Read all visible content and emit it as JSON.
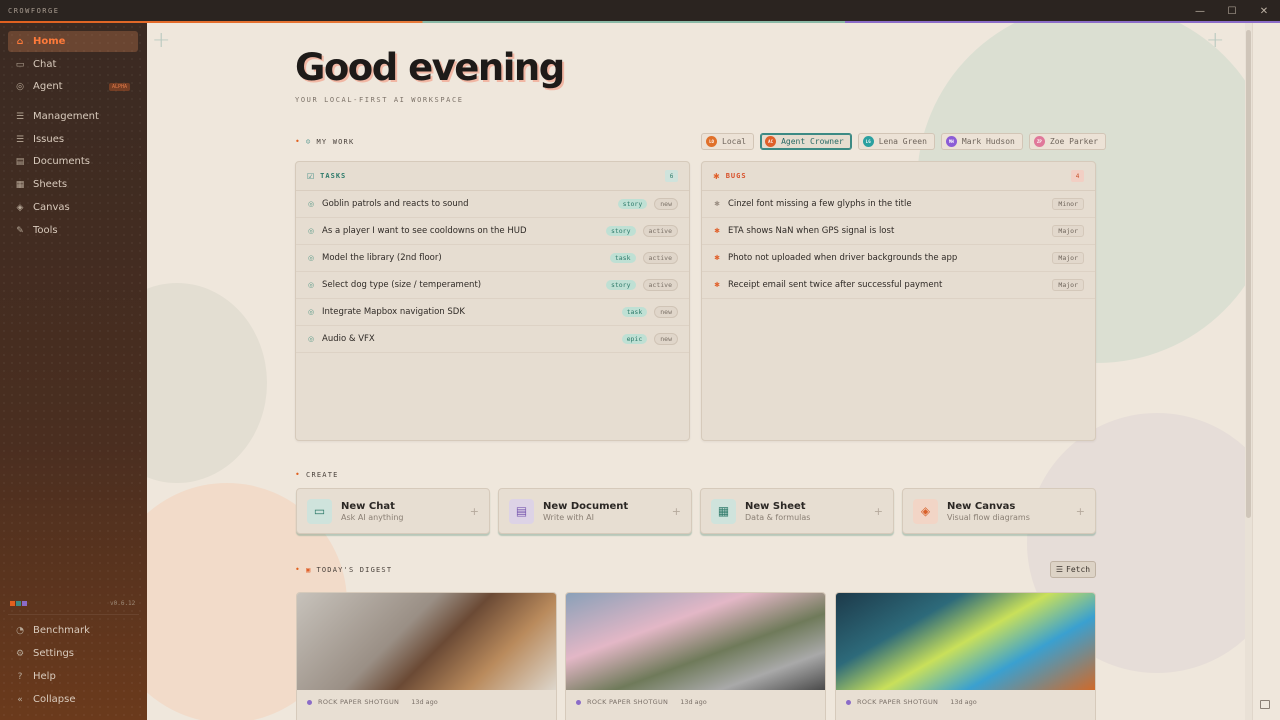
{
  "app": {
    "title": "CROWFORGE",
    "version": "v0.6.12"
  },
  "window_controls": [
    "—",
    "☐",
    "✕"
  ],
  "sidebar": {
    "items": [
      {
        "label": "Home",
        "icon": "home-icon",
        "glyph": "⌂",
        "active": true
      },
      {
        "label": "Chat",
        "icon": "chat-icon",
        "glyph": "▭"
      },
      {
        "label": "Agent",
        "icon": "agent-icon",
        "glyph": "◎",
        "badge": "ALPHA"
      },
      {
        "label": "Management",
        "icon": "management-icon",
        "glyph": "☰"
      },
      {
        "label": "Issues",
        "icon": "issues-icon",
        "glyph": "☰"
      },
      {
        "label": "Documents",
        "icon": "documents-icon",
        "glyph": "▤"
      },
      {
        "label": "Sheets",
        "icon": "sheets-icon",
        "glyph": "▦"
      },
      {
        "label": "Canvas",
        "icon": "canvas-icon",
        "glyph": "◈"
      },
      {
        "label": "Tools",
        "icon": "tools-icon",
        "glyph": "✎"
      }
    ],
    "footer": [
      {
        "label": "Benchmark",
        "icon": "benchmark-icon",
        "glyph": "◔"
      },
      {
        "label": "Settings",
        "icon": "settings-icon",
        "glyph": "⚙"
      },
      {
        "label": "Help",
        "icon": "help-icon",
        "glyph": "?"
      },
      {
        "label": "Collapse",
        "icon": "collapse-icon",
        "glyph": "«"
      }
    ]
  },
  "header": {
    "greeting": "Good evening",
    "subtitle": "YOUR LOCAL-FIRST AI WORKSPACE"
  },
  "my_work": {
    "label": "MY WORK",
    "users": [
      {
        "name": "Local",
        "initials": "LO",
        "color": "#e0702a",
        "selected": false
      },
      {
        "name": "Agent Crowner",
        "initials": "AC",
        "color": "#e0602a",
        "selected": true
      },
      {
        "name": "Lena Green",
        "initials": "LG",
        "color": "#2ba0a0",
        "selected": false
      },
      {
        "name": "Mark Hudson",
        "initials": "MH",
        "color": "#8b5cd6",
        "selected": false
      },
      {
        "name": "Zoe Parker",
        "initials": "ZP",
        "color": "#e0789a",
        "selected": false
      }
    ]
  },
  "tasks": {
    "title": "TASKS",
    "count": "6",
    "items": [
      {
        "title": "Goblin patrols and reacts to sound",
        "type": "story",
        "status": "new"
      },
      {
        "title": "As a player I want to see cooldowns on the HUD",
        "type": "story",
        "status": "active"
      },
      {
        "title": "Model the library (2nd floor)",
        "type": "task",
        "status": "active"
      },
      {
        "title": "Select dog type (size / temperament)",
        "type": "story",
        "status": "active"
      },
      {
        "title": "Integrate Mapbox navigation SDK",
        "type": "task",
        "status": "new"
      },
      {
        "title": "Audio & VFX",
        "type": "epic",
        "status": "new"
      }
    ]
  },
  "bugs": {
    "title": "BUGS",
    "count": "4",
    "items": [
      {
        "title": "Cinzel font missing a few glyphs in the title",
        "severity": "Minor"
      },
      {
        "title": "ETA shows NaN when GPS signal is lost",
        "severity": "Major"
      },
      {
        "title": "Photo not uploaded when driver backgrounds the app",
        "severity": "Major"
      },
      {
        "title": "Receipt email sent twice after successful payment",
        "severity": "Major"
      }
    ]
  },
  "create": {
    "label": "CREATE",
    "cards": [
      {
        "title": "New Chat",
        "subtitle": "Ask AI anything",
        "icon": "chat-icon",
        "glyph": "▭",
        "bg": "#cfe3dc",
        "fg": "#2f7a6a"
      },
      {
        "title": "New Document",
        "subtitle": "Write with AI",
        "icon": "document-icon",
        "glyph": "▤",
        "bg": "#ddd3e6",
        "fg": "#7a5ab0"
      },
      {
        "title": "New Sheet",
        "subtitle": "Data & formulas",
        "icon": "sheet-icon",
        "glyph": "▦",
        "bg": "#cfe3dc",
        "fg": "#2f7a6a"
      },
      {
        "title": "New Canvas",
        "subtitle": "Visual flow diagrams",
        "icon": "canvas-icon",
        "glyph": "◈",
        "bg": "#f2d5c6",
        "fg": "#d8602a"
      }
    ]
  },
  "digest": {
    "label": "TODAY'S DIGEST",
    "fetch_label": "Fetch",
    "cards": [
      {
        "source": "ROCK PAPER SHOTGUN",
        "age": "13d ago"
      },
      {
        "source": "ROCK PAPER SHOTGUN",
        "age": "13d ago"
      },
      {
        "source": "ROCK PAPER SHOTGUN",
        "age": "13d ago"
      }
    ]
  },
  "colors": {
    "accent": "#e0601f",
    "teal": "#3c8a84",
    "purple": "#8b6cc8"
  }
}
